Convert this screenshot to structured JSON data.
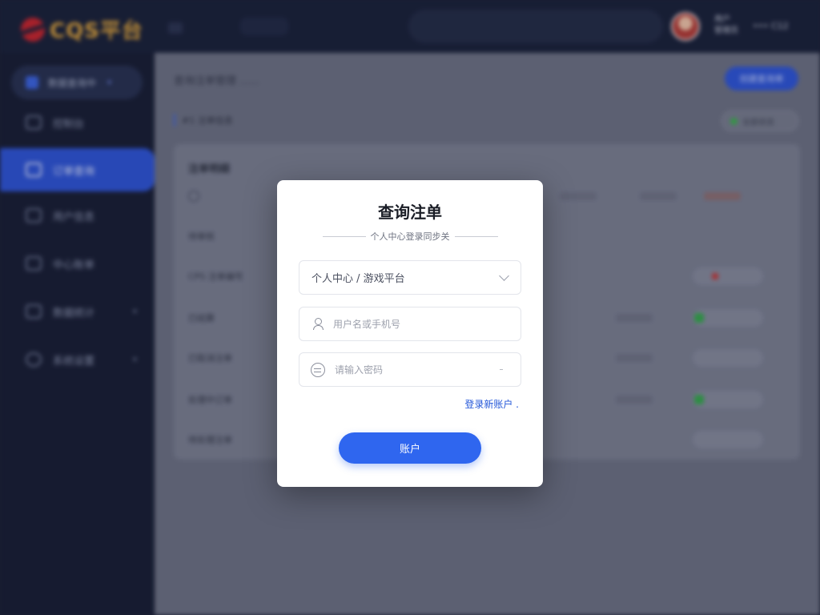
{
  "header": {
    "logo_text": "CQS平台",
    "user_line1": "用户",
    "user_line2": "管理员",
    "user_extra": "•••  C12"
  },
  "sidebar": {
    "switcher_label": "数据查询中",
    "items": [
      {
        "label": "控制台",
        "icon": "monitor-icon"
      },
      {
        "label": "订单查询",
        "icon": "card-icon",
        "active": true
      },
      {
        "label": "用户信息",
        "icon": "user-icon"
      },
      {
        "label": "中心账单",
        "icon": "wallet-icon"
      },
      {
        "label": "数据统计",
        "icon": "chart-icon"
      },
      {
        "label": "系统设置",
        "icon": "gear-icon"
      }
    ]
  },
  "main": {
    "breadcrumb": "查询注单管理 ......",
    "create_label": "创建查询单",
    "section_label": "#1 注单信息",
    "filter_label": "全部状态",
    "card_title": "注单明细",
    "rows": [
      {
        "label": "待审核"
      },
      {
        "label": "CPS 注单编号"
      },
      {
        "label": "已结算"
      },
      {
        "label": "已取消注单"
      },
      {
        "label": "处理中订单"
      },
      {
        "label": "待处理注单"
      }
    ]
  },
  "modal": {
    "title": "查询注单",
    "subtitle": "个人中心登录同步关",
    "select_value": "个人中心 / 游戏平台",
    "username_placeholder": "用户名或手机号",
    "password_placeholder": "请输入密码",
    "register_link": "登录新账户 .",
    "submit_label": "账户"
  },
  "colors": {
    "accent": "#2f66ef",
    "sidebar_bg": "#171d33",
    "active_nav": "#2d54d6",
    "logo_gold": "#e1a63c",
    "logo_red": "#c7242c"
  }
}
